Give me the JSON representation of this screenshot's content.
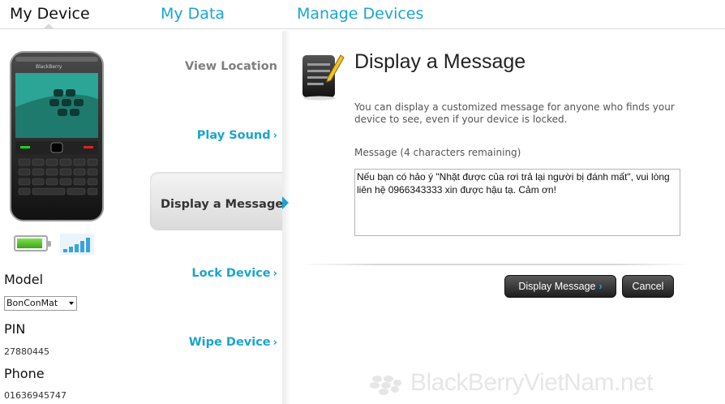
{
  "tabs": {
    "my_device": "My Device",
    "my_data": "My Data",
    "manage_devices": "Manage Devices"
  },
  "device": {
    "model_label": "Model",
    "model_value": "BonConMat",
    "pin_label": "PIN",
    "pin_value": "27880445",
    "phone_label": "Phone",
    "phone_value": "01636945747",
    "battery_level": 0.9,
    "signal_bars": 5,
    "signal_color": "#3aa3dd",
    "battery_color": "#5cc834"
  },
  "actions": {
    "view_location": "View Location",
    "play_sound": "Play Sound",
    "display_message": "Display a Message",
    "lock_device": "Lock Device",
    "wipe_device": "Wipe Device",
    "chevron": "›"
  },
  "content": {
    "title": "Display a Message",
    "description": "You can display a customized message for anyone who finds your device to see, even if your device is locked.",
    "message_label": "Message (4 characters remaining)",
    "message_value": "Nếu bạn có hảo ý \"Nhặt được của rơi trả lại người bị đánh mất\", vui lòng liên hệ 0966343333 xin được hậu tạ. Cảm ơn!"
  },
  "buttons": {
    "display_message": "Display Message",
    "cancel": "Cancel"
  },
  "watermark": "BlackBerryVietNam.net",
  "colors": {
    "accent": "#1aa5cf",
    "text_dark": "#111111"
  }
}
